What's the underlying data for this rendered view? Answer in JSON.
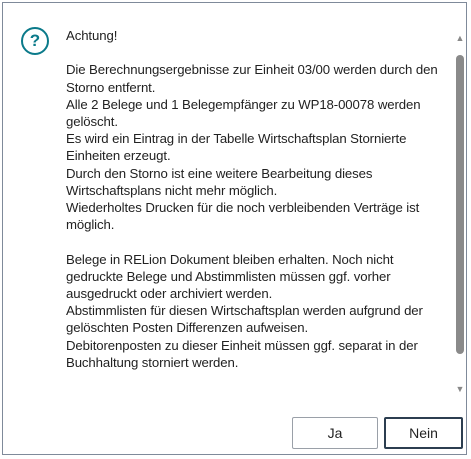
{
  "dialog": {
    "icon": "question-circle-icon",
    "icon_glyph": "?",
    "message": "Achtung!\n\nDie Berechnungsergebnisse zur Einheit 03/00 werden durch den Storno entfernt.\nAlle 2 Belege und 1 Belegempfänger zu WP18-00078 werden gelöscht.\nEs wird ein Eintrag in der Tabelle Wirtschaftsplan Stornierte Einheiten erzeugt.\nDurch den Storno ist eine weitere Bearbeitung dieses Wirtschaftsplans nicht mehr möglich.\nWiederholtes Drucken für die noch verbleibenden Verträge ist möglich.\n\nBelege in RELion Dokument bleiben erhalten. Noch nicht gedruckte Belege und Abstimmlisten müssen ggf. vorher ausgedruckt oder archiviert werden.\nAbstimmlisten für diesen Wirtschaftsplan werden aufgrund der gelöschten Posten Differenzen aufweisen.\nDebitorenposten zu dieser Einheit müssen ggf. separat in der Buchhaltung storniert werden."
  },
  "buttons": {
    "yes_label": "Ja",
    "no_label": "Nein"
  },
  "colors": {
    "icon": "#0b7a8a",
    "default_button_border": "#2c3e50"
  }
}
